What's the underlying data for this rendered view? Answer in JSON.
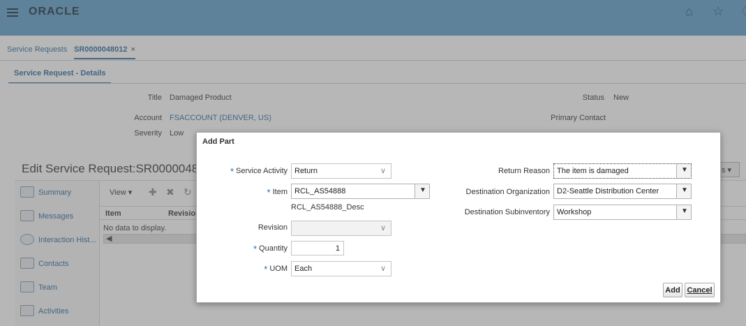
{
  "header": {
    "logo": "ORACLE",
    "icons": [
      "menu-icon",
      "home-icon",
      "star-icon",
      "bell-icon"
    ]
  },
  "tabs": [
    {
      "label": "Service Requests"
    },
    {
      "label": "SR0000048012",
      "close": "×"
    }
  ],
  "subtab": {
    "label": "Service Request - Details"
  },
  "details": {
    "title_label": "Title",
    "title_value": "Damaged Product",
    "account_label": "Account",
    "account_value": "FSACCOUNT (DENVER, US)",
    "severity_label": "Severity",
    "severity_value": "Low",
    "status_label": "Status",
    "status_value": "New",
    "primary_contact_label": "Primary Contact"
  },
  "edit_title": "Edit Service Request:SR000004801",
  "leftnav": {
    "items": [
      {
        "label": "Summary"
      },
      {
        "label": "Messages"
      },
      {
        "label": "Interaction Hist..."
      },
      {
        "label": "Contacts"
      },
      {
        "label": "Team"
      },
      {
        "label": "Activities"
      }
    ]
  },
  "content": {
    "view_label": "View ▾",
    "columns": [
      "Item",
      "Revision"
    ],
    "no_data": "No data to display.",
    "scroll_arrow": "◀"
  },
  "bg_button_label": "s ▾",
  "dialog": {
    "title": "Add Part",
    "service_activity_label": "Service Activity",
    "service_activity_value": "Return",
    "item_label": "Item",
    "item_value": "RCL_AS54888",
    "item_desc": "RCL_AS54888_Desc",
    "revision_label": "Revision",
    "revision_value": "",
    "quantity_label": "Quantity",
    "quantity_value": "1",
    "uom_label": "UOM",
    "uom_value": "Each",
    "return_reason_label": "Return Reason",
    "return_reason_value": "The item is damaged",
    "dest_org_label": "Destination Organization",
    "dest_org_value": "D2-Seattle Distribution Center",
    "dest_subinv_label": "Destination Subinventory",
    "dest_subinv_value": "Workshop",
    "required_marker": "*",
    "add_label": "Add",
    "cancel_label": "Cancel"
  },
  "colors": {
    "header_bg": "#5e9fc9",
    "link": "#2b6aa0",
    "overlay": "rgba(95,95,95,0.45)"
  }
}
